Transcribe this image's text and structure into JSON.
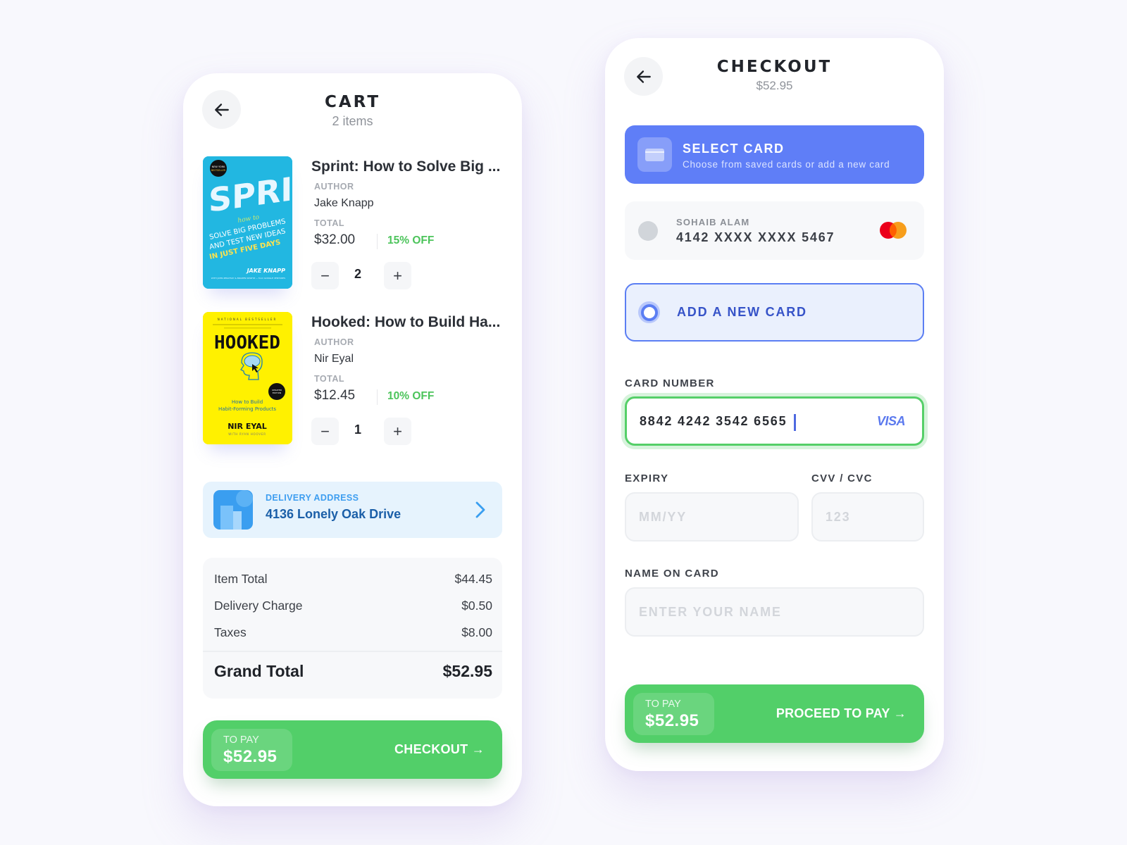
{
  "cart": {
    "back_label": "Back",
    "title": "CART",
    "subtitle": "2 items",
    "items": [
      {
        "title": "Sprint: How to Solve Big ...",
        "author_label": "AUTHOR",
        "author": "Jake Knapp",
        "total_label": "TOTAL",
        "price": "$32.00",
        "discount": "15% OFF",
        "quantity": "2",
        "cover": {
          "badge": "NEW YORK TIMES BESTSELLER",
          "title": "SPRINT",
          "tag": "how to",
          "lines": [
            "SOLVE BIG PROBLEMS",
            "AND TEST NEW IDEAS",
            "IN JUST FIVE DAYS"
          ],
          "author": "JAKE KNAPP",
          "credits": "WITH JOHN ZERATSKY & BRADEN KOWITZ — from GOOGLE VENTURES"
        }
      },
      {
        "title": "Hooked: How to Build Ha...",
        "author_label": "AUTHOR",
        "author": "Nir Eyal",
        "total_label": "TOTAL",
        "price": "$12.45",
        "discount": "10% OFF",
        "quantity": "1",
        "cover": {
          "badge": "NATIONAL BESTSELLER",
          "title": "HOOKED",
          "subtitle_1": "How to Build",
          "subtitle_2": "Habit-Forming Products",
          "author": "NIR EYAL",
          "credits": "WITH RYAN HOOVER"
        }
      }
    ],
    "qty_minus": "−",
    "qty_plus": "+",
    "delivery": {
      "label": "DELIVERY ADDRESS",
      "address": "4136  Lonely Oak Drive"
    },
    "summary": {
      "rows": [
        {
          "label": "Item Total",
          "value": "$44.45"
        },
        {
          "label": "Delivery Charge",
          "value": "$0.50"
        },
        {
          "label": "Taxes",
          "value": "$8.00"
        }
      ],
      "grand_label": "Grand Total",
      "grand_value": "$52.95"
    },
    "pay": {
      "label": "TO PAY",
      "amount": "$52.95",
      "cta": "CHECKOUT →"
    }
  },
  "checkout": {
    "title": "CHECKOUT",
    "subtitle": "$52.95",
    "select_card": {
      "title": "SELECT CARD",
      "subtitle": "Choose from saved cards or add a new card"
    },
    "saved_card": {
      "holder": "SOHAIB ALAM",
      "number": "4142 XXXX XXXX 5467",
      "brand": "mastercard"
    },
    "add_card_label": "ADD A NEW CARD",
    "fields": {
      "card_number_label": "CARD NUMBER",
      "card_number_value": "8842 4242 3542 6565",
      "card_brand": "VISA",
      "expiry_label": "EXPIRY",
      "expiry_placeholder": "MM/YY",
      "cvv_label": "CVV / CVC",
      "cvv_placeholder": "123",
      "name_label": "NAME ON CARD",
      "name_placeholder": "ENTER YOUR NAME"
    },
    "pay": {
      "label": "TO PAY",
      "amount": "$52.95",
      "cta": "PROCEED TO PAY →"
    }
  },
  "colors": {
    "accent_green": "#52cf69",
    "accent_blue": "#5f7ef7",
    "discount_green": "#4cc45b",
    "delivery_bg": "#e6f3fd"
  }
}
